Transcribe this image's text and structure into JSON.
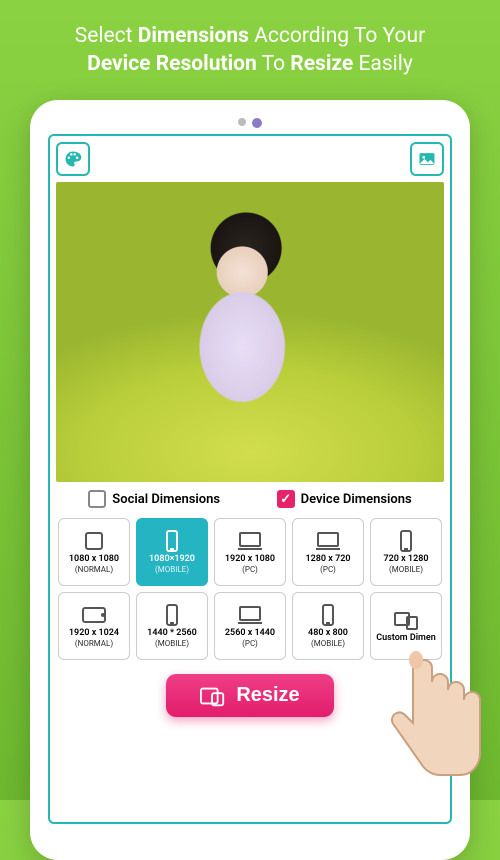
{
  "headline": {
    "t1": "Select ",
    "b1": "Dimensions",
    "t2": " According To Your",
    "b2": "Device Resolution",
    "t3": " To ",
    "b3": "Resize",
    "t4": " Easily"
  },
  "toggles": {
    "social_label": "Social Dimensions",
    "device_label": "Device Dimensions"
  },
  "tiles": [
    {
      "dim": "1080 x 1080",
      "tag": "(NORMAL)",
      "kind": "square",
      "selected": false
    },
    {
      "dim": "1080×1920",
      "tag": "(MOBILE)",
      "kind": "phone",
      "selected": true
    },
    {
      "dim": "1920 x 1080",
      "tag": "(PC)",
      "kind": "laptop",
      "selected": false
    },
    {
      "dim": "1280 x 720",
      "tag": "(PC)",
      "kind": "laptop",
      "selected": false
    },
    {
      "dim": "720 x 1280",
      "tag": "(MOBILE)",
      "kind": "phone",
      "selected": false
    },
    {
      "dim": "1920 x 1024",
      "tag": "(NORMAL)",
      "kind": "tabletls",
      "selected": false
    },
    {
      "dim": "1440 * 2560",
      "tag": "(MOBILE)",
      "kind": "phone",
      "selected": false
    },
    {
      "dim": "2560 x 1440",
      "tag": "(PC)",
      "kind": "laptop",
      "selected": false
    },
    {
      "dim": "480 x 800",
      "tag": "(MOBILE)",
      "kind": "phone",
      "selected": false
    },
    {
      "dim": "Custom Dimen",
      "tag": "",
      "kind": "custom",
      "selected": false
    }
  ],
  "resize_label": "Resize"
}
